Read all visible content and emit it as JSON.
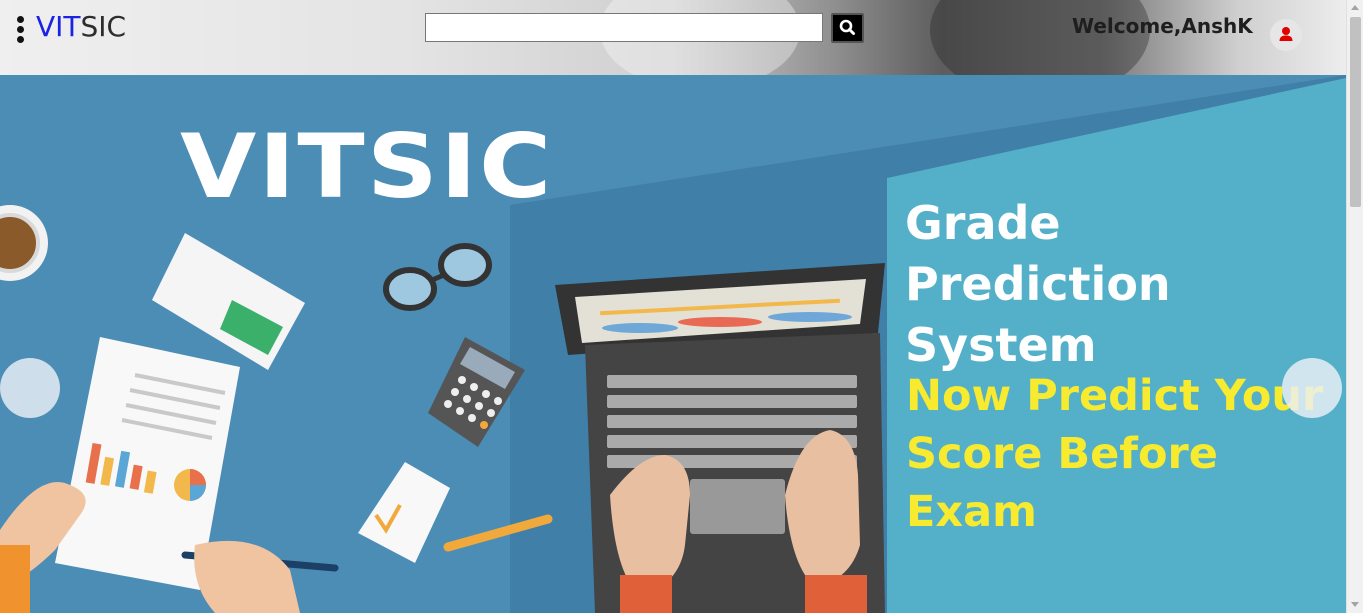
{
  "header": {
    "menu_icon": "vertical-dots-icon",
    "logo_part1": "VIT",
    "logo_part2": "SIC",
    "search": {
      "value": "",
      "placeholder": "",
      "icon": "search-icon"
    },
    "welcome_text": "Welcome,AnshK",
    "user_icon": "user-icon"
  },
  "hero": {
    "brand": "VITSIC",
    "title_line1": "Grade Prediction",
    "title_line2": "System",
    "tagline_line1": "Now Predict Your",
    "tagline_line2": "Score Before",
    "tagline_line3": "Exam",
    "prev_icon": "chevron-left-icon",
    "next_icon": "chevron-right-icon"
  },
  "colors": {
    "logo_accent": "#1a22e6",
    "hero_background": "#4c8db6",
    "panel": "#54b0c8",
    "tagline": "#f7ea2f",
    "user_icon": "#e00000"
  }
}
